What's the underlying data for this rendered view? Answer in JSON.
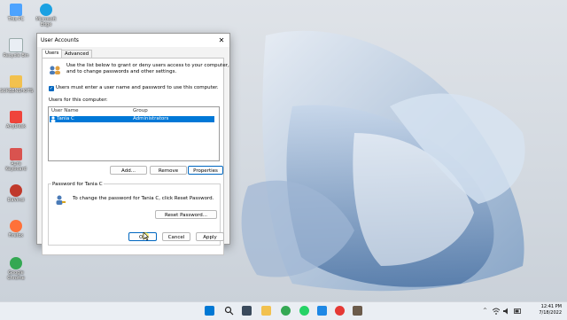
{
  "desktop": {
    "icons": [
      {
        "label": "This PC",
        "color": "#4da3ff"
      },
      {
        "label": "Microsoft Edge",
        "color": "#1ba1e2"
      },
      {
        "label": "Recycle Bin",
        "color": "#e9eef4"
      },
      {
        "label": "SCREENSHOTS",
        "color": "#f2c14e"
      },
      {
        "label": "AnyDesk",
        "color": "#ef443b"
      },
      {
        "label": "Aura Keyboard",
        "color": "#d9534f"
      },
      {
        "label": "DaVinci",
        "color": "#c0392b"
      },
      {
        "label": "Firefox",
        "color": "#ff7139"
      },
      {
        "label": "Google Chrome",
        "color": "#34a853"
      }
    ]
  },
  "dialog": {
    "title": "User Accounts",
    "close_symbol": "✕",
    "tabs": [
      "Users",
      "Advanced"
    ],
    "intro_line1": "Use the list below to grant or deny users access to your computer,",
    "intro_line2": "and to change passwords and other settings.",
    "checkbox_label": "Users must enter a user name and password to use this computer.",
    "checkbox_checked": true,
    "users_label": "Users for this computer:",
    "columns": [
      "User Name",
      "Group"
    ],
    "rows": [
      {
        "name": "Tania C",
        "group": "Administrators",
        "selected": true
      }
    ],
    "buttons": {
      "add": "Add...",
      "remove": "Remove",
      "properties": "Properties"
    },
    "password_group": {
      "title": "Password for Tania C",
      "text": "To change the password for Tania C, click Reset Password.",
      "reset_button": "Reset Password..."
    },
    "footer": {
      "ok": "OK",
      "cancel": "Cancel",
      "apply": "Apply"
    }
  },
  "taskbar": {
    "time": "12:41 PM",
    "date": "7/18/2022",
    "tray_chevron": "^"
  },
  "colors": {
    "accent": "#0078d7",
    "selection": "#0078d7"
  }
}
